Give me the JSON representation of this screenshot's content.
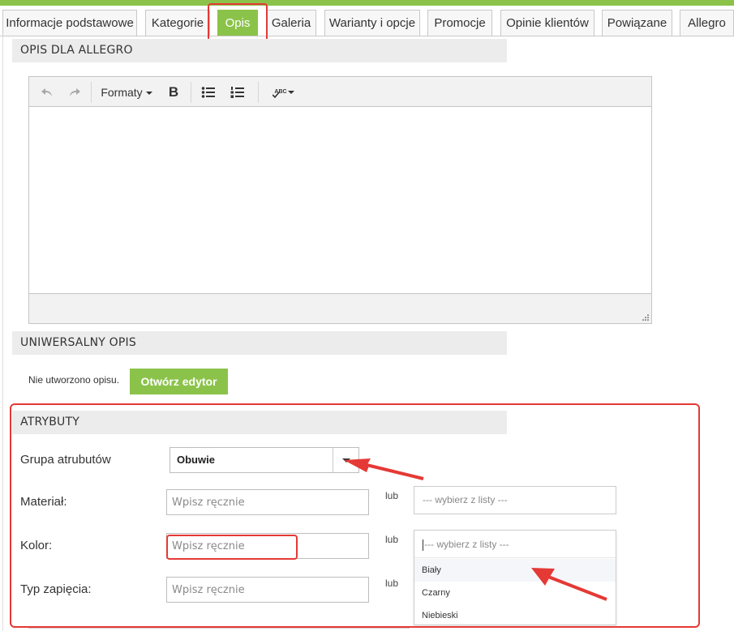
{
  "tabs": [
    {
      "label": "Informacje podstawowe",
      "active": false
    },
    {
      "label": "Kategorie",
      "active": false
    },
    {
      "label": "Opis",
      "active": true
    },
    {
      "label": "Galeria",
      "active": false
    },
    {
      "label": "Warianty i opcje",
      "active": false
    },
    {
      "label": "Promocje",
      "active": false
    },
    {
      "label": "Opinie klientów",
      "active": false
    },
    {
      "label": "Powiązane",
      "active": false
    },
    {
      "label": "Allegro",
      "active": false
    }
  ],
  "sections": {
    "allegro": "OPIS DLA ALLEGRO",
    "universal": "UNIWERSALNY OPIS",
    "attributes": "ATRYBUTY"
  },
  "editor": {
    "formats_label": "Formaty",
    "bold_label": "B",
    "spellcheck_label": "ABC"
  },
  "universal": {
    "status_text": "Nie utworzono opisu.",
    "open_editor_label": "Otwórz edytor"
  },
  "attributes": {
    "group_label": "Grupa atrubutów",
    "group_value": "Obuwie",
    "fields": [
      {
        "label": "Materiał:",
        "placeholder": "Wpisz ręcznie",
        "or": "lub",
        "list_placeholder": "--- wybierz z listy ---"
      },
      {
        "label": "Kolor:",
        "placeholder": "Wpisz ręcznie",
        "or": "lub",
        "list_placeholder": "--- wybierz z listy ---"
      },
      {
        "label": "Typ zapięcia:",
        "placeholder": "Wpisz ręcznie",
        "or": "lub"
      }
    ],
    "color_options": [
      "Biały",
      "Czarny",
      "Niebieski"
    ]
  },
  "colors": {
    "accent": "#8bc34a",
    "highlight": "#e53935"
  }
}
